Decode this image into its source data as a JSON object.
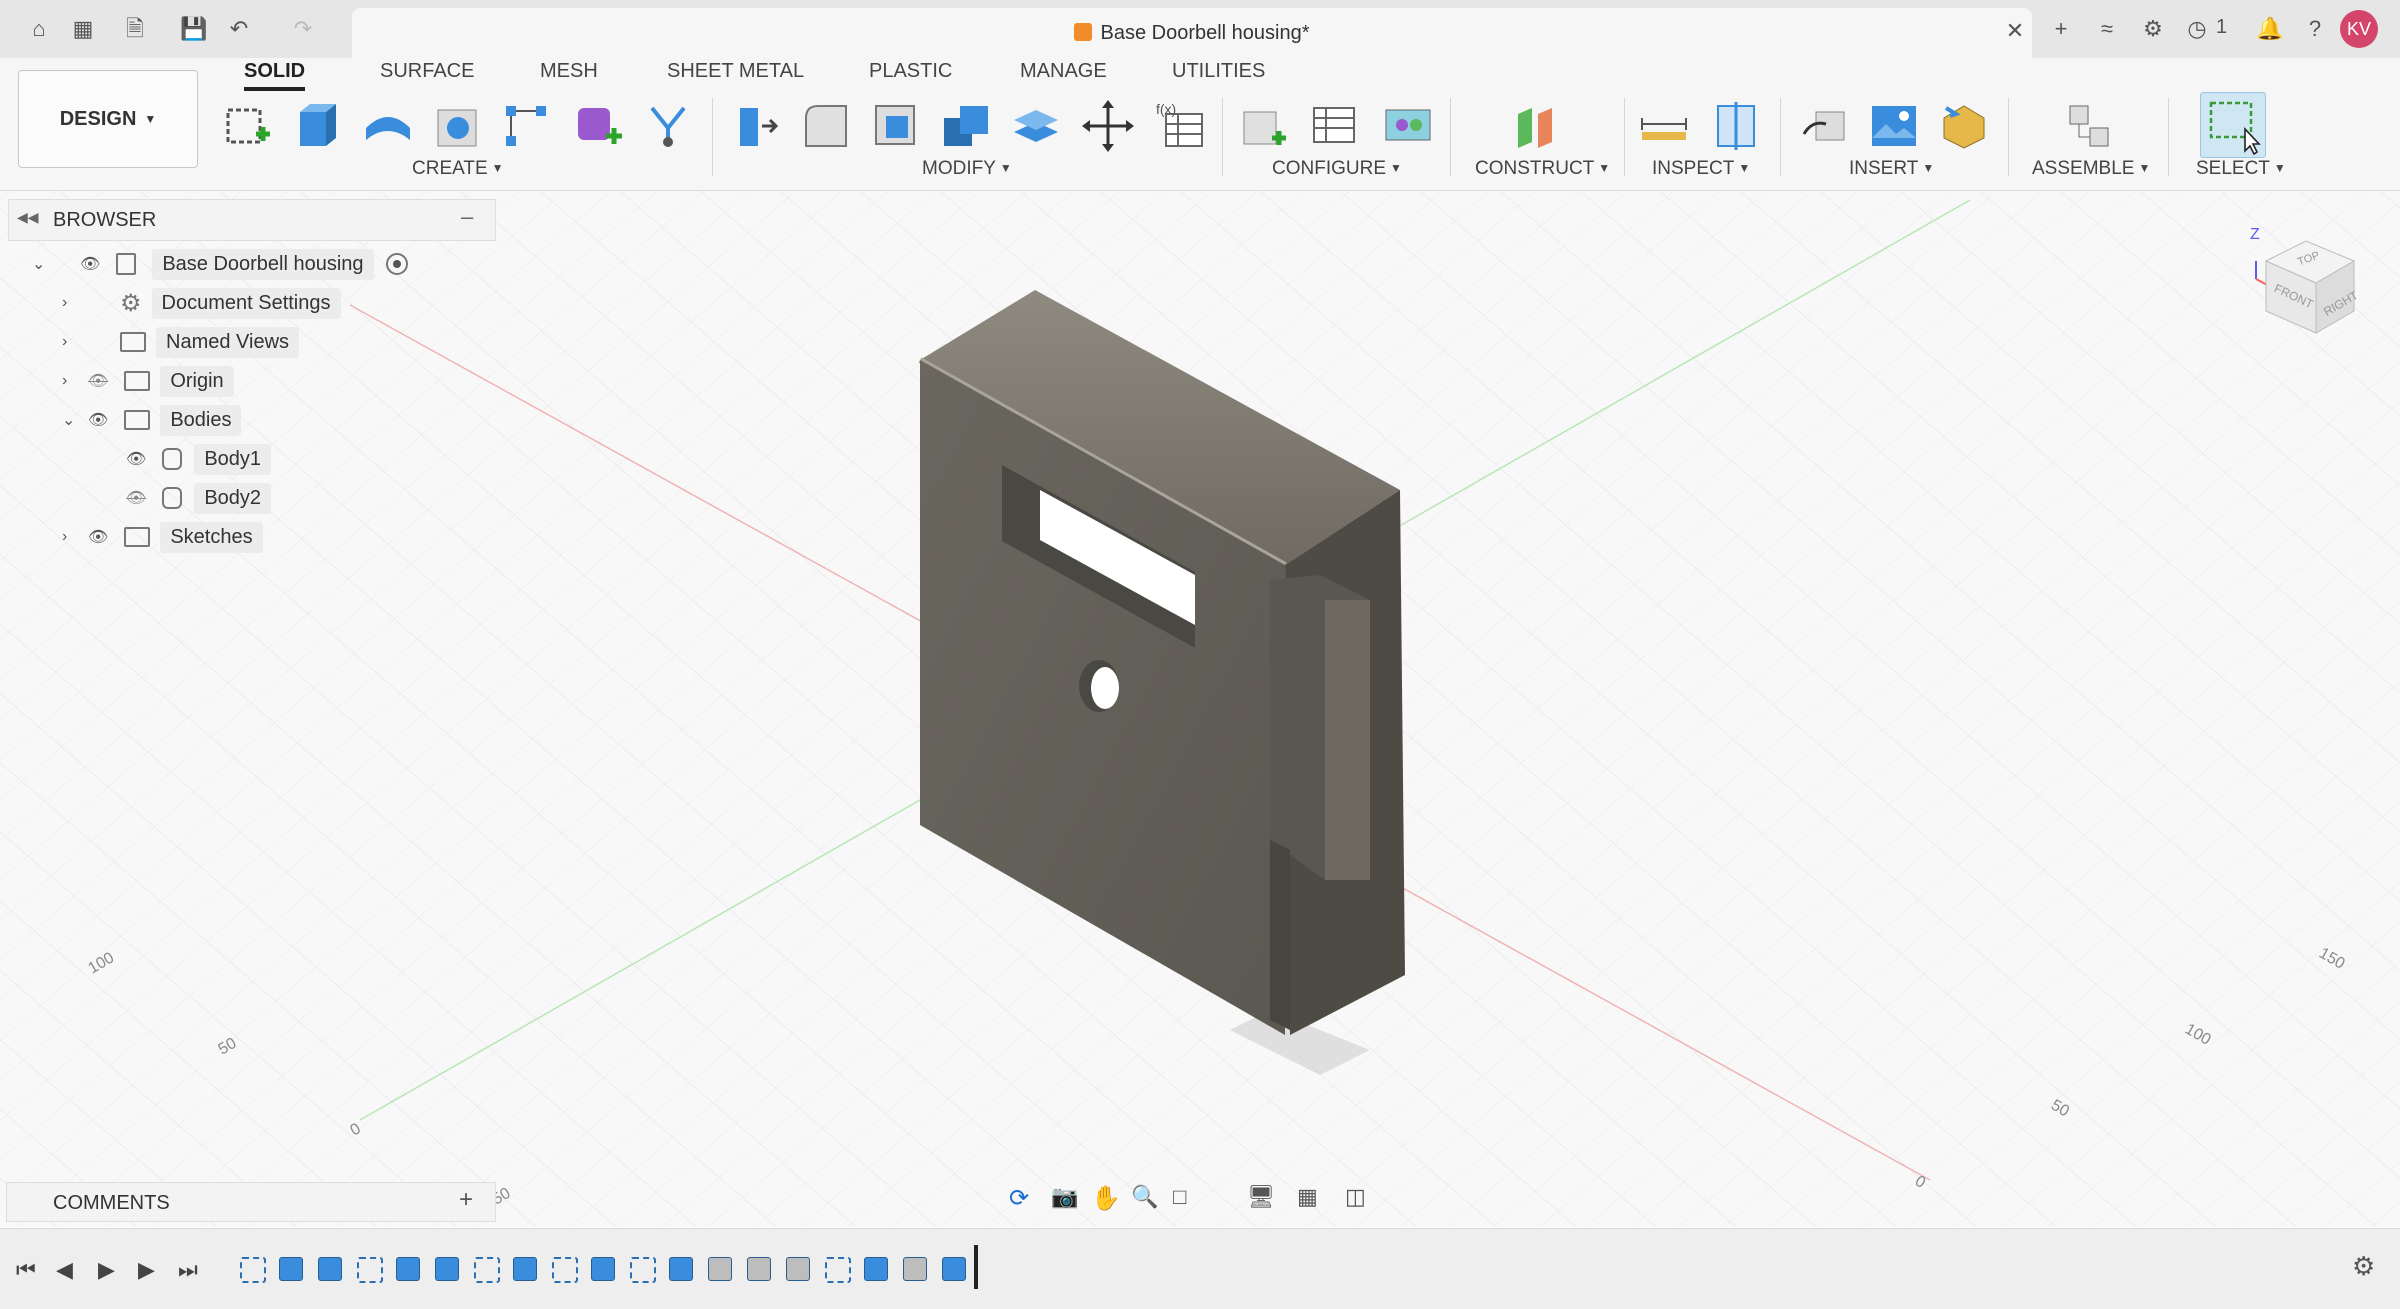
{
  "window": {
    "doc_title": "Base Doorbell housing*",
    "job_count": "1",
    "user_initials": "KV",
    "accent": "#d4456b"
  },
  "toolbar": {
    "workspace": "DESIGN",
    "tabs": [
      "SOLID",
      "SURFACE",
      "MESH",
      "SHEET METAL",
      "PLASTIC",
      "MANAGE",
      "UTILITIES"
    ],
    "groups": {
      "create": "CREATE",
      "modify": "MODIFY",
      "configure": "CONFIGURE",
      "construct": "CONSTRUCT",
      "inspect": "INSPECT",
      "insert": "INSERT",
      "assemble": "ASSEMBLE",
      "select": "SELECT"
    }
  },
  "browser": {
    "title": "BROWSER",
    "root": "Base Doorbell housing",
    "items": [
      {
        "label": "Document Settings"
      },
      {
        "label": "Named Views"
      },
      {
        "label": "Origin"
      },
      {
        "label": "Bodies"
      },
      {
        "label": "Body1"
      },
      {
        "label": "Body2"
      },
      {
        "label": "Sketches"
      }
    ]
  },
  "comments": {
    "title": "COMMENTS"
  },
  "viewcube": {
    "top": "TOP",
    "front": "FRONT",
    "right": "RIGHT",
    "z": "Z",
    "x": "X"
  },
  "grid_labels": [
    "100",
    "50",
    "0",
    "50",
    "150",
    "100",
    "50",
    "0"
  ]
}
